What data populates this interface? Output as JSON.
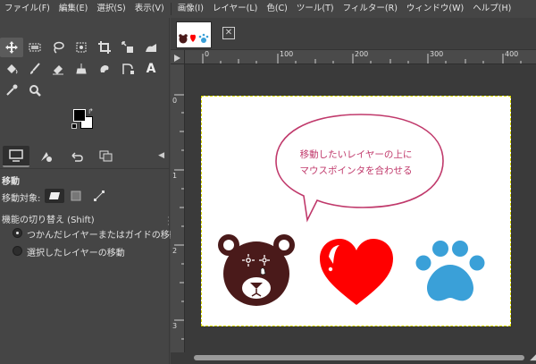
{
  "menubar": {
    "items": [
      "ファイル(F)",
      "編集(E)",
      "選択(S)",
      "表示(V)",
      "画像(I)",
      "レイヤー(L)",
      "色(C)",
      "ツール(T)",
      "フィルター(R)",
      "ウィンドウ(W)",
      "ヘルプ(H)"
    ]
  },
  "toolbox": {
    "row1": [
      "move-icon",
      "rect-select-icon",
      "lasso-icon",
      "fuzzy-select-icon",
      "crop-icon",
      "unified-transform-icon",
      "warp-icon"
    ],
    "row2": [
      "bucket-fill-icon",
      "paintbrush-icon",
      "eraser-icon",
      "clone-icon",
      "smudge-icon",
      "path-icon",
      "text-icon"
    ],
    "row3": [
      "color-picker-icon",
      "zoom-icon"
    ]
  },
  "tool_options": {
    "title": "移動",
    "move_target_label": "移動対象:",
    "toggle_label": "機能の切り替え (Shift)",
    "radio1_label": "つかんだレイヤーまたはガイドの移動",
    "radio2_label": "選択したレイヤーの移動"
  },
  "canvas": {
    "hruler_labels": [
      "0",
      "100",
      "200",
      "300",
      "400"
    ],
    "vruler_labels": [
      "0",
      "1",
      "2",
      "3"
    ],
    "bubble_line1": "移動したいレイヤーの上に",
    "bubble_line2": "マウスポインタを合わせる",
    "bubble_color": "#c0396b",
    "bear_color": "#4a1a1a",
    "heart_color": "#ff0000",
    "paw_color": "#3aa0d8"
  }
}
